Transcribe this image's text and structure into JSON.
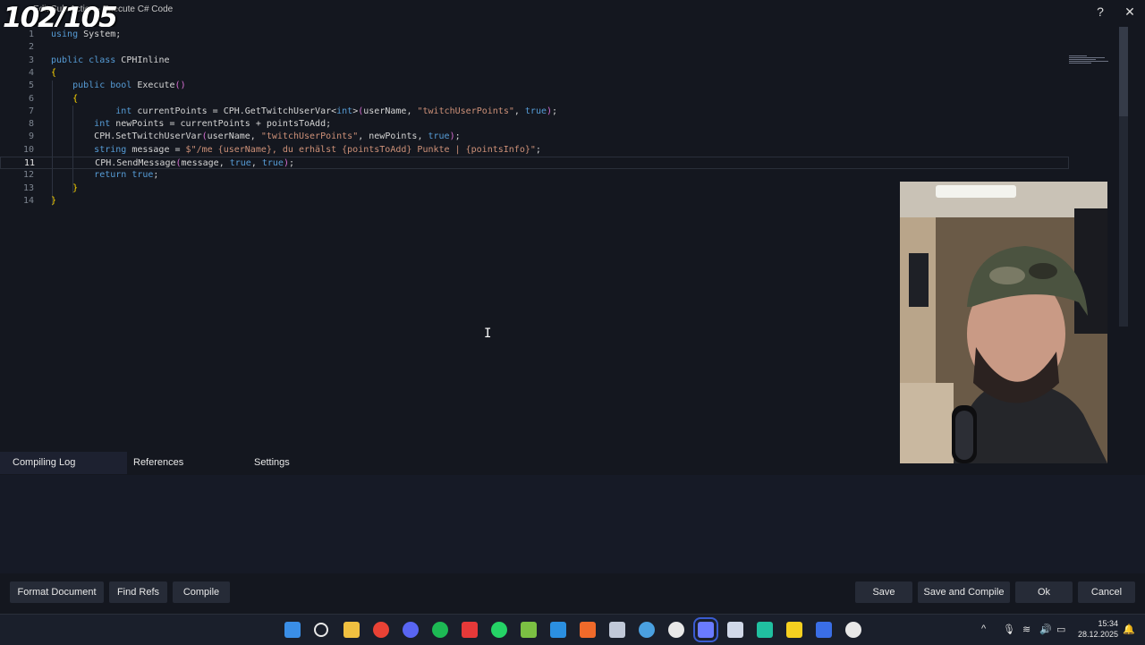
{
  "window": {
    "counter": "102/105",
    "title": "Edit Sub-Action - Execute C# Code",
    "help_label": "?",
    "close_label": "✕"
  },
  "editor": {
    "active_line": 11,
    "lines": [
      {
        "n": "1",
        "t": "using System;"
      },
      {
        "n": "2",
        "t": ""
      },
      {
        "n": "3",
        "t": "public class CPHInline"
      },
      {
        "n": "4",
        "t": "{"
      },
      {
        "n": "5",
        "t": "    public bool Execute()"
      },
      {
        "n": "6",
        "t": "    {"
      },
      {
        "n": "7",
        "t": "            int currentPoints = CPH.GetTwitchUserVar<int>(userName, \"twitchUserPoints\", true);"
      },
      {
        "n": "8",
        "t": "        int newPoints = currentPoints + pointsToAdd;"
      },
      {
        "n": "9",
        "t": "        CPH.SetTwitchUserVar(userName, \"twitchUserPoints\", newPoints, true);"
      },
      {
        "n": "10",
        "t": "        string message = $\"/me {userName}, du erhälst {pointsToAdd} Punkte | {pointsInfo}\";"
      },
      {
        "n": "11",
        "t": "        CPH.SendMessage(message, true, true);"
      },
      {
        "n": "12",
        "t": "        return true;"
      },
      {
        "n": "13",
        "t": "    }"
      },
      {
        "n": "14",
        "t": "}"
      }
    ]
  },
  "tabs": [
    {
      "label": "Compiling Log",
      "active": true
    },
    {
      "label": "References",
      "active": false
    },
    {
      "label": "Settings",
      "active": false
    }
  ],
  "buttons": {
    "format": "Format Document",
    "find_refs": "Find Refs",
    "compile": "Compile",
    "save": "Save",
    "save_compile": "Save and Compile",
    "ok": "Ok",
    "cancel": "Cancel"
  },
  "taskbar": {
    "icons": [
      "windows-start-icon",
      "search-icon",
      "file-explorer-icon",
      "chrome-icon",
      "discord-icon",
      "spotify-icon",
      "app-red-diamond-icon",
      "whatsapp-icon",
      "notepad-plus-icon",
      "vscode-icon",
      "affinity-icon",
      "steam-icon",
      "obs-orb-icon",
      "obs-studio-icon",
      "streamerbot-icon",
      "audio-editor-icon",
      "green-app-icon",
      "sticky-notes-icon",
      "davinci-resolve-icon",
      "chatgpt-icon"
    ],
    "time": "15:34",
    "date": "28.12.2025",
    "tray_chevron": "^"
  },
  "colors": {
    "background": "#14171f",
    "keyword": "#569cd6",
    "string": "#ce9178",
    "brace": "#ffd700"
  }
}
